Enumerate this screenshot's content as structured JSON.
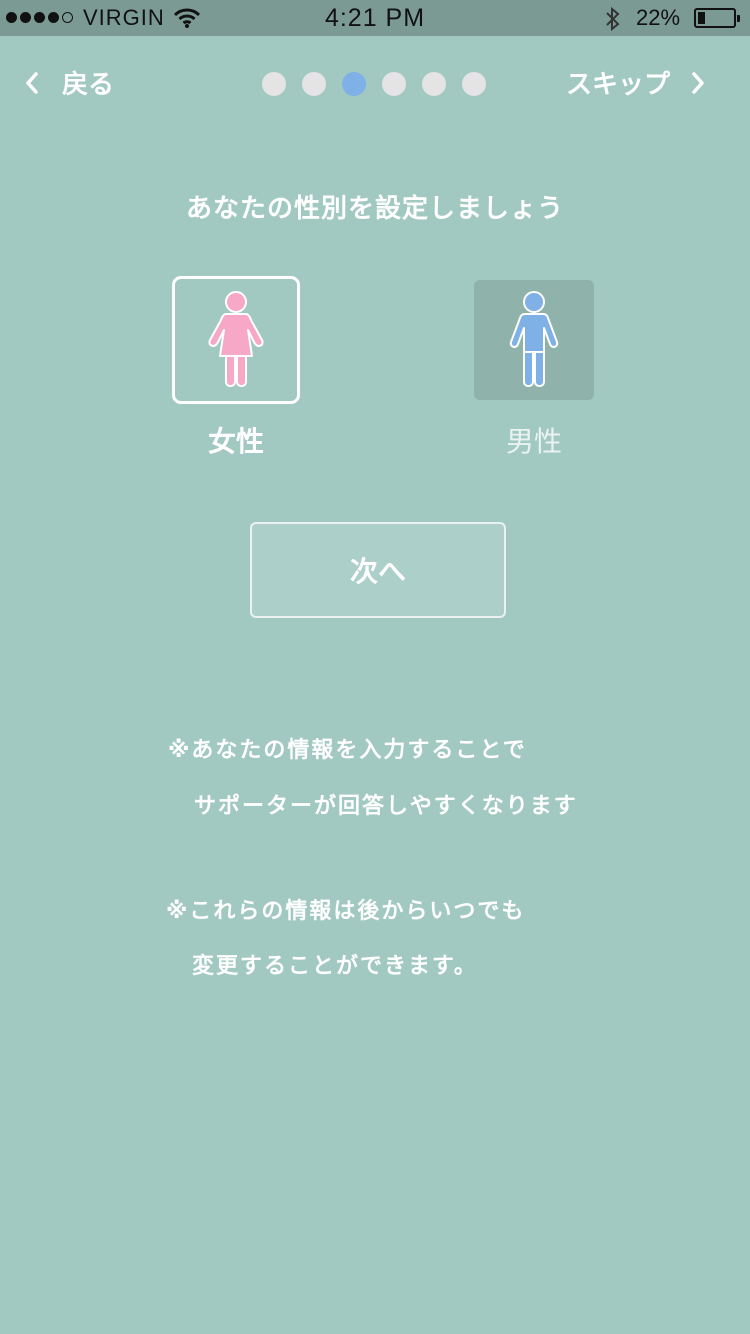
{
  "status_bar": {
    "carrier": "VIRGIN",
    "time": "4:21 PM",
    "battery_pct": "22%",
    "battery_level": 0.22
  },
  "nav": {
    "back_label": "戻る",
    "skip_label": "スキップ",
    "steps_total": 6,
    "active_step": 3
  },
  "title": "あなたの性別を設定しましょう",
  "options": {
    "female": {
      "label": "女性",
      "color": "#f7a8c6",
      "selected": true
    },
    "male": {
      "label": "男性",
      "color": "#7fb0e6",
      "selected": false
    }
  },
  "next_label": "次へ",
  "notes": [
    "※あなたの情報を入力することで",
    "サポーターが回答しやすくなります",
    "※これらの情報は後からいつでも",
    "変更することができます。"
  ],
  "colors": {
    "background": "#a2c9c1",
    "status_bar": "#7b9a94",
    "active_dot": "#7fb0e6",
    "inactive_dot": "#e4e4e4"
  }
}
